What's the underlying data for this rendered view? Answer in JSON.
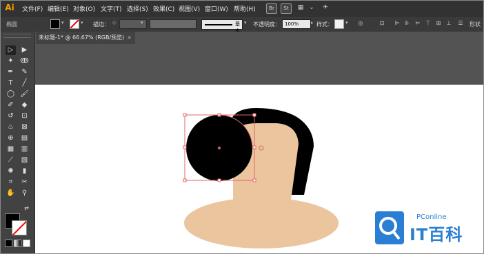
{
  "app": {
    "logo_text": "Ai",
    "brand_color": "#ff9a00"
  },
  "menubar": {
    "items": [
      "文件(F)",
      "编辑(E)",
      "对象(O)",
      "文字(T)",
      "选择(S)",
      "效果(C)",
      "视图(V)",
      "窗口(W)",
      "帮助(H)"
    ],
    "bridge_label": "Br",
    "stock_label": "St"
  },
  "controlbar": {
    "selection_label": "椭圆",
    "stroke_label": "描边：",
    "stroke_style_label": "基本",
    "opacity_label": "不透明度：",
    "opacity_value": "100%",
    "style_label": "样式：",
    "right_label": "形状"
  },
  "document": {
    "tab_title": "未标题-1* @ 66.67% (RGB/预览)",
    "close_glyph": "×"
  },
  "tools": {
    "icons": [
      "selection-tool-icon",
      "direct-selection-tool-icon",
      "magic-wand-icon",
      "lasso-icon",
      "pen-icon",
      "curvature-icon",
      "type-icon",
      "line-icon",
      "ellipse-icon",
      "paintbrush-icon",
      "shaper-icon",
      "eraser-icon",
      "rotate-icon",
      "scale-icon",
      "warp-icon",
      "free-transform-icon",
      "shape-builder-icon",
      "perspective-icon",
      "mesh-icon",
      "gradient-icon",
      "eyedropper-icon",
      "blend-icon",
      "symbol-sprayer-icon",
      "graph-icon",
      "artboard-icon",
      "slice-icon",
      "hand-icon",
      "zoom-icon"
    ]
  },
  "colors": {
    "hair": "#000000",
    "skin": "#ebc59d",
    "selection": "#e06666",
    "watermark": "#2a7fd4"
  },
  "watermark": {
    "small_text": "PConline",
    "big_text": "IT百科"
  }
}
